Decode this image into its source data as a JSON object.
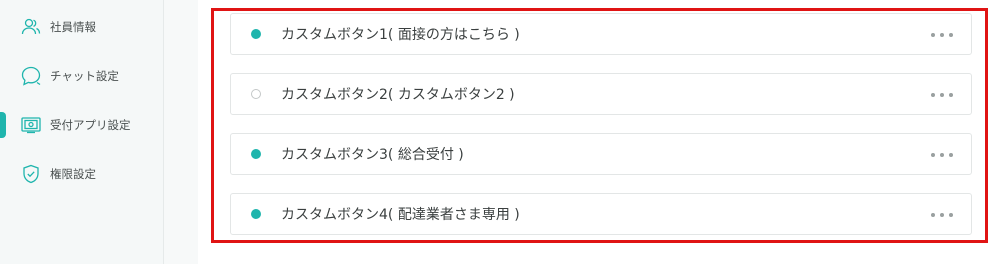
{
  "sidebar": {
    "items": [
      {
        "label": "社員情報",
        "icon": "users-icon",
        "active": false
      },
      {
        "label": "チャット設定",
        "icon": "chat-icon",
        "active": false
      },
      {
        "label": "受付アプリ設定",
        "icon": "reception-app-icon",
        "active": true
      },
      {
        "label": "権限設定",
        "icon": "shield-check-icon",
        "active": false
      }
    ]
  },
  "buttons": [
    {
      "title": "カスタムボタン1( 面接の方はこちら )",
      "enabled": true
    },
    {
      "title": "カスタムボタン2( カスタムボタン2 )",
      "enabled": false
    },
    {
      "title": "カスタムボタン3( 総合受付 )",
      "enabled": true
    },
    {
      "title": "カスタムボタン4( 配達業者さま専用 )",
      "enabled": true
    }
  ],
  "colors": {
    "accent": "#1fb5ad",
    "highlight": "#e01414",
    "inactive_dot": "#c4c8c8"
  }
}
